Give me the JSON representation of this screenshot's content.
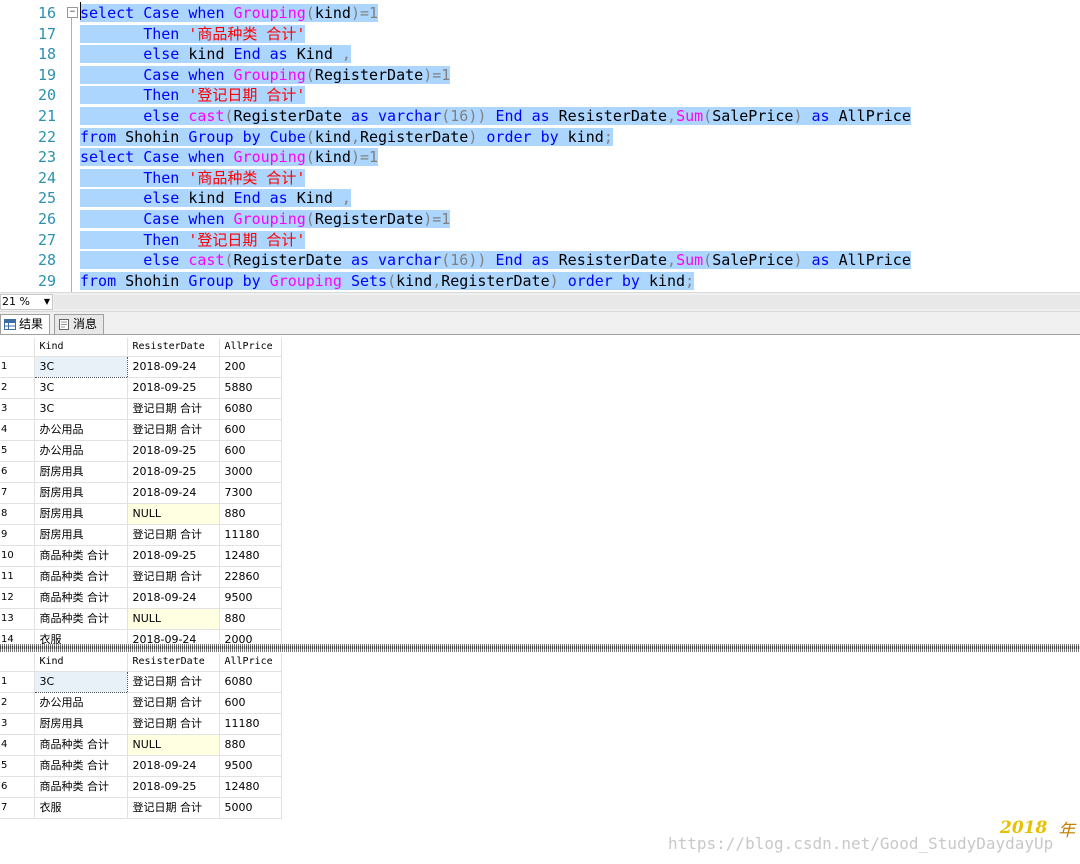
{
  "editor": {
    "line_numbers": [
      "16",
      "17",
      "18",
      "19",
      "20",
      "21",
      "22",
      "23",
      "24",
      "25",
      "26",
      "27",
      "28",
      "29"
    ],
    "lines": [
      [
        [
          "kw",
          "select"
        ],
        [
          "",
          "·"
        ],
        [
          "kw",
          "Case"
        ],
        [
          "",
          "·"
        ],
        [
          "kw",
          "when"
        ],
        [
          "",
          "·"
        ],
        [
          "fn",
          "Grouping"
        ],
        [
          "op",
          "("
        ],
        [
          "",
          "kind"
        ],
        [
          "op",
          ")=1"
        ]
      ],
      [
        [
          "",
          "·······"
        ],
        [
          "kw",
          "Then"
        ],
        [
          "",
          "·"
        ],
        [
          "st",
          "'商品种类 合计'"
        ]
      ],
      [
        [
          "",
          "·······"
        ],
        [
          "kw",
          "else"
        ],
        [
          "",
          "·kind·"
        ],
        [
          "kw",
          "End"
        ],
        [
          "",
          "·"
        ],
        [
          "kw",
          "as"
        ],
        [
          "",
          "·Kind·"
        ],
        [
          "op",
          ","
        ]
      ],
      [
        [
          "",
          "·······"
        ],
        [
          "kw",
          "Case"
        ],
        [
          "",
          "·"
        ],
        [
          "kw",
          "when"
        ],
        [
          "",
          "·"
        ],
        [
          "fn",
          "Grouping"
        ],
        [
          "op",
          "("
        ],
        [
          "",
          "RegisterDate"
        ],
        [
          "op",
          ")=1"
        ]
      ],
      [
        [
          "",
          "·······"
        ],
        [
          "kw",
          "Then"
        ],
        [
          "",
          "·"
        ],
        [
          "st",
          "'登记日期 合计'"
        ]
      ],
      [
        [
          "",
          "·······"
        ],
        [
          "kw",
          "else"
        ],
        [
          "",
          "·"
        ],
        [
          "fn",
          "cast"
        ],
        [
          "op",
          "("
        ],
        [
          "",
          "RegisterDate·"
        ],
        [
          "kw",
          "as"
        ],
        [
          "",
          "·"
        ],
        [
          "kw",
          "varchar"
        ],
        [
          "op",
          "(16))"
        ],
        [
          "",
          "·"
        ],
        [
          "kw",
          "End"
        ],
        [
          "",
          "·"
        ],
        [
          "kw",
          "as"
        ],
        [
          "",
          "·ResisterDate"
        ],
        [
          "op",
          ","
        ],
        [
          "fn",
          "Sum"
        ],
        [
          "op",
          "("
        ],
        [
          "",
          "SalePrice"
        ],
        [
          "op",
          ")"
        ],
        [
          "",
          "·"
        ],
        [
          "kw",
          "as"
        ],
        [
          "",
          "·AllPrice"
        ]
      ],
      [
        [
          "kw",
          "from"
        ],
        [
          "",
          "·Shohin·"
        ],
        [
          "kw",
          "Group"
        ],
        [
          "",
          "·"
        ],
        [
          "kw",
          "by"
        ],
        [
          "",
          "·"
        ],
        [
          "kw",
          "Cube"
        ],
        [
          "op",
          "("
        ],
        [
          "",
          "kind"
        ],
        [
          "op",
          ","
        ],
        [
          "",
          "RegisterDate"
        ],
        [
          "op",
          ")"
        ],
        [
          "",
          "·"
        ],
        [
          "kw",
          "order"
        ],
        [
          "",
          "·"
        ],
        [
          "kw",
          "by"
        ],
        [
          "",
          "·kind"
        ],
        [
          "op",
          ";"
        ]
      ],
      [
        [
          "kw",
          "select"
        ],
        [
          "",
          "·"
        ],
        [
          "kw",
          "Case"
        ],
        [
          "",
          "·"
        ],
        [
          "kw",
          "when"
        ],
        [
          "",
          "·"
        ],
        [
          "fn",
          "Grouping"
        ],
        [
          "op",
          "("
        ],
        [
          "",
          "kind"
        ],
        [
          "op",
          ")=1"
        ]
      ],
      [
        [
          "",
          "·······"
        ],
        [
          "kw",
          "Then"
        ],
        [
          "",
          "·"
        ],
        [
          "st",
          "'商品种类 合计'"
        ]
      ],
      [
        [
          "",
          "·······"
        ],
        [
          "kw",
          "else"
        ],
        [
          "",
          "·kind·"
        ],
        [
          "kw",
          "End"
        ],
        [
          "",
          "·"
        ],
        [
          "kw",
          "as"
        ],
        [
          "",
          "·Kind·"
        ],
        [
          "op",
          ","
        ]
      ],
      [
        [
          "",
          "·······"
        ],
        [
          "kw",
          "Case"
        ],
        [
          "",
          "·"
        ],
        [
          "kw",
          "when"
        ],
        [
          "",
          "·"
        ],
        [
          "fn",
          "Grouping"
        ],
        [
          "op",
          "("
        ],
        [
          "",
          "RegisterDate"
        ],
        [
          "op",
          ")=1"
        ]
      ],
      [
        [
          "",
          "·······"
        ],
        [
          "kw",
          "Then"
        ],
        [
          "",
          "·"
        ],
        [
          "st",
          "'登记日期 合计'"
        ]
      ],
      [
        [
          "",
          "·······"
        ],
        [
          "kw",
          "else"
        ],
        [
          "",
          "·"
        ],
        [
          "fn",
          "cast"
        ],
        [
          "op",
          "("
        ],
        [
          "",
          "RegisterDate·"
        ],
        [
          "kw",
          "as"
        ],
        [
          "",
          "·"
        ],
        [
          "kw",
          "varchar"
        ],
        [
          "op",
          "(16))"
        ],
        [
          "",
          "·"
        ],
        [
          "kw",
          "End"
        ],
        [
          "",
          "·"
        ],
        [
          "kw",
          "as"
        ],
        [
          "",
          "·ResisterDate"
        ],
        [
          "op",
          ","
        ],
        [
          "fn",
          "Sum"
        ],
        [
          "op",
          "("
        ],
        [
          "",
          "SalePrice"
        ],
        [
          "op",
          ")"
        ],
        [
          "",
          "·"
        ],
        [
          "kw",
          "as"
        ],
        [
          "",
          "·AllPrice"
        ]
      ],
      [
        [
          "kw",
          "from"
        ],
        [
          "",
          "·Shohin·"
        ],
        [
          "kw",
          "Group"
        ],
        [
          "",
          "·"
        ],
        [
          "kw",
          "by"
        ],
        [
          "",
          "·"
        ],
        [
          "fn",
          "Grouping"
        ],
        [
          "",
          "·"
        ],
        [
          "kw",
          "Sets"
        ],
        [
          "op",
          "("
        ],
        [
          "",
          "kind"
        ],
        [
          "op",
          ","
        ],
        [
          "",
          "RegisterDate"
        ],
        [
          "op",
          ")"
        ],
        [
          "",
          "·"
        ],
        [
          "kw",
          "order"
        ],
        [
          "",
          "·"
        ],
        [
          "kw",
          "by"
        ],
        [
          "",
          "·kind"
        ],
        [
          "op",
          ";"
        ]
      ]
    ]
  },
  "zoom": {
    "value": "21 %"
  },
  "tabs": [
    {
      "label": "结果",
      "icon": "grid-icon"
    },
    {
      "label": "消息",
      "icon": "message-icon"
    }
  ],
  "results": [
    {
      "columns": [
        "Kind",
        "ResisterDate",
        "AllPrice"
      ],
      "rows": [
        [
          "1",
          "3C",
          "2018-09-24",
          "200"
        ],
        [
          "2",
          "3C",
          "2018-09-25",
          "5880"
        ],
        [
          "3",
          "3C",
          "登记日期 合计",
          "6080"
        ],
        [
          "4",
          "办公用品",
          "登记日期 合计",
          "600"
        ],
        [
          "5",
          "办公用品",
          "2018-09-25",
          "600"
        ],
        [
          "6",
          "厨房用具",
          "2018-09-25",
          "3000"
        ],
        [
          "7",
          "厨房用具",
          "2018-09-24",
          "7300"
        ],
        [
          "8",
          "厨房用具",
          "NULL",
          "880"
        ],
        [
          "9",
          "厨房用具",
          "登记日期 合计",
          "11180"
        ],
        [
          "10",
          "商品种类 合计",
          "2018-09-25",
          "12480"
        ],
        [
          "11",
          "商品种类 合计",
          "登记日期 合计",
          "22860"
        ],
        [
          "12",
          "商品种类 合计",
          "2018-09-24",
          "9500"
        ],
        [
          "13",
          "商品种类 合计",
          "NULL",
          "880"
        ],
        [
          "14",
          "衣服",
          "2018-09-24",
          "2000"
        ]
      ]
    },
    {
      "columns": [
        "Kind",
        "ResisterDate",
        "AllPrice"
      ],
      "rows": [
        [
          "1",
          "3C",
          "登记日期 合计",
          "6080"
        ],
        [
          "2",
          "办公用品",
          "登记日期 合计",
          "600"
        ],
        [
          "3",
          "厨房用具",
          "登记日期 合计",
          "11180"
        ],
        [
          "4",
          "商品种类 合计",
          "NULL",
          "880"
        ],
        [
          "5",
          "商品种类 合计",
          "2018-09-24",
          "9500"
        ],
        [
          "6",
          "商品种类 合计",
          "2018-09-25",
          "12480"
        ],
        [
          "7",
          "衣服",
          "登记日期 合计",
          "5000"
        ]
      ]
    }
  ],
  "watermark": "https://blog.csdn.net/Good_StudyDaydayUp",
  "logo_text": "2018",
  "logo_char": "年",
  "colors": {
    "selection": "#add6ff",
    "keyword": "#0000ff",
    "function": "#ff00ff",
    "string": "#ff0000",
    "line_number": "#2b91af",
    "null_cell": "#ffffe1"
  }
}
